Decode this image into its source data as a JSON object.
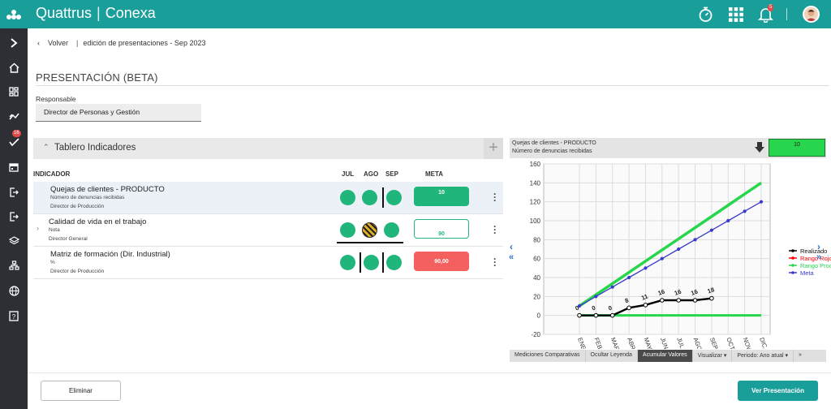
{
  "app": {
    "brand": "Quattrus",
    "product": "Conexa",
    "notification_count": "5",
    "menu_badge": "16"
  },
  "breadcrumb": {
    "back": "Volver",
    "current": "edición de presentaciones - Sep 2023"
  },
  "page": {
    "title": "PRESENTACIÓN (BETA)",
    "responsable_label": "Responsable",
    "responsable_value": "Director de Personas y Gestión"
  },
  "panel": {
    "title": "Tablero Indicadores",
    "columns": {
      "indicator": "INDICADOR",
      "jul": "JUL",
      "ago": "AGO",
      "sep": "SEP",
      "meta": "META"
    },
    "rows": [
      {
        "name": "Quejas de clientes - PRODUCTO",
        "unit": "Número de denuncias recibidas",
        "owner": "Director de Producción",
        "meta": "10",
        "meta_state": "green"
      },
      {
        "name": "Calidad de vida en el trabajo",
        "unit": "Nota",
        "owner": "Director General",
        "meta": "90",
        "meta_state": "outline"
      },
      {
        "name": "Matriz de formación (Dir. Industrial)",
        "unit": "%",
        "owner": "Director de Producción",
        "meta": "90,00",
        "meta_state": "red"
      }
    ]
  },
  "chart_header": {
    "line1": "Quejas de clientes - PRODUCTO",
    "line2": "Número de denuncias recibidas",
    "value": "10"
  },
  "chart_data": {
    "type": "line",
    "categories": [
      "ENE. / 23",
      "FEB.",
      "MAR.",
      "ABR.",
      "MAY.",
      "JUN.",
      "JUL.",
      "AGO.",
      "SEP.",
      "OCT.",
      "NOV.",
      "DIC. / 23"
    ],
    "ylim": [
      -20,
      160
    ],
    "yticks": [
      -20,
      0,
      20,
      40,
      60,
      80,
      100,
      120,
      140,
      160
    ],
    "series": [
      {
        "name": "Realizado",
        "color": "#000000",
        "values": [
          0,
          0,
          0,
          8,
          11,
          16,
          16,
          16,
          18,
          null,
          null,
          null
        ],
        "labels": [
          "0",
          "0",
          "0",
          "8",
          "11",
          "16",
          "16",
          "16",
          "18"
        ]
      },
      {
        "name": "Rango Rojo",
        "color": "#ff0000",
        "values": []
      },
      {
        "name": "Rango Procesc",
        "color": "#27d64c",
        "values": [
          10,
          21.8,
          33.6,
          45.5,
          57.3,
          69.1,
          80.9,
          92.7,
          104.5,
          116.4,
          128.2,
          140
        ]
      },
      {
        "name": "Meta",
        "color": "#3a3acc",
        "values": [
          10,
          20,
          30,
          40,
          50,
          60,
          70,
          80,
          90,
          100,
          110,
          120
        ]
      }
    ],
    "baseline_color": "#27d64c",
    "grid": true,
    "legend": "right"
  },
  "chart_tabs": [
    "Mediciones Comparativas",
    "Ocultar Leyenda",
    "Acumular Valores",
    "Visualizar ▾",
    "Periodo: Ano atual ▾",
    "»"
  ],
  "buttons": {
    "delete": "Eliminar",
    "view": "Ver Presentación"
  }
}
